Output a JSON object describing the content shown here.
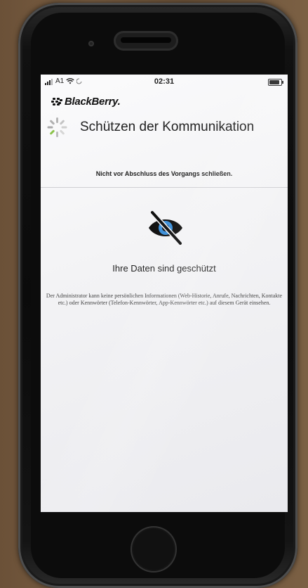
{
  "status_bar": {
    "carrier": "A1",
    "time": "02:31"
  },
  "app": {
    "brand": "BlackBerry.",
    "title": "Schützen der Kommunikation",
    "warning": "Nicht vor Abschluss des Vorgangs schließen.",
    "protected_label": "Ihre Daten sind geschützt",
    "description": "Der Administrator kann keine persönlichen Informationen (Web-Historie, Anrufe, Nachrichten, Kontakte etc.) oder Kennwörter (Telefon-Kennwörter, App-Kennwörter etc.) auf diesem Gerät einsehen."
  },
  "icons": {
    "brand": "blackberry-logo-icon",
    "progress": "loading-spinner-icon",
    "privacy": "eye-slash-icon"
  },
  "colors": {
    "screen_bg": "#f4f4f6",
    "text": "#222222",
    "spinner_gray": "#b5b5b5",
    "spinner_green": "#8bc34a",
    "eye_dark": "#101010",
    "eye_blue": "#3b8fd9"
  }
}
